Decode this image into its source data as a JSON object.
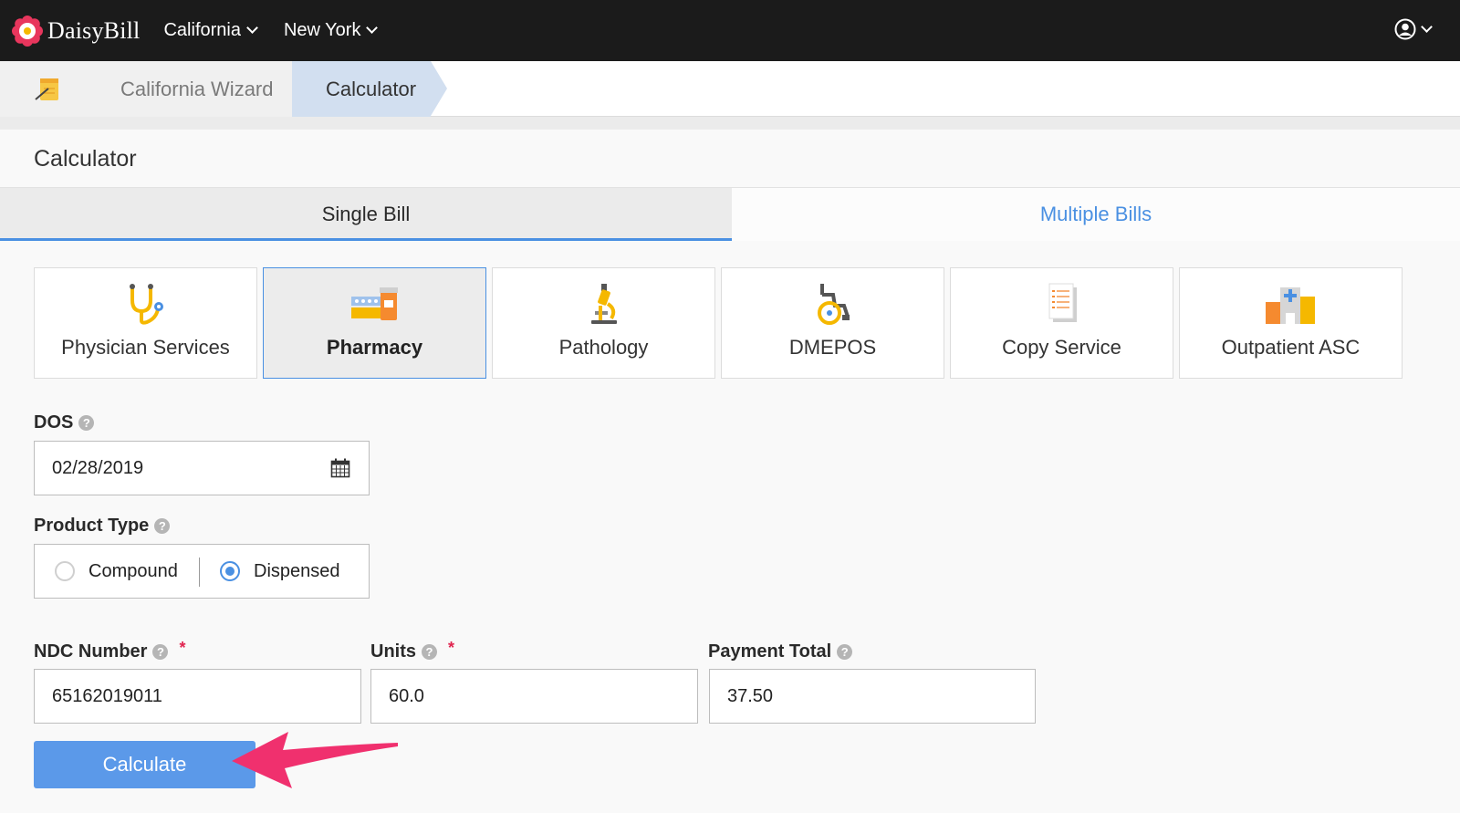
{
  "navbar": {
    "brand": "DaisyBill",
    "menus": [
      {
        "label": "California"
      },
      {
        "label": "New York"
      }
    ]
  },
  "breadcrumb": {
    "items": [
      "California Wizard",
      "Calculator"
    ]
  },
  "page": {
    "title": "Calculator"
  },
  "tabs": [
    {
      "label": "Single Bill",
      "active": true
    },
    {
      "label": "Multiple Bills",
      "active": false
    }
  ],
  "bill_types": [
    {
      "label": "Physician Services",
      "icon": "stethoscope-icon"
    },
    {
      "label": "Pharmacy",
      "icon": "pharmacy-icon",
      "selected": true
    },
    {
      "label": "Pathology",
      "icon": "microscope-icon"
    },
    {
      "label": "DMEPOS",
      "icon": "wheelchair-icon"
    },
    {
      "label": "Copy Service",
      "icon": "document-icon"
    },
    {
      "label": "Outpatient ASC",
      "icon": "hospital-icon"
    }
  ],
  "form": {
    "dos": {
      "label": "DOS",
      "value": "02/28/2019"
    },
    "product_type": {
      "label": "Product Type",
      "options": [
        {
          "label": "Compound",
          "checked": false
        },
        {
          "label": "Dispensed",
          "checked": true
        }
      ]
    },
    "ndc": {
      "label": "NDC Number",
      "value": "65162019011"
    },
    "units": {
      "label": "Units",
      "value": "60.0"
    },
    "payment_total": {
      "label": "Payment Total",
      "value": "37.50"
    },
    "help_glyph": "?",
    "required_glyph": "*"
  },
  "actions": {
    "calculate_label": "Calculate"
  },
  "colors": {
    "accent": "#4a90e2",
    "button": "#5b99e9",
    "annotation_arrow": "#f0306e",
    "navbar": "#1b1b1b"
  }
}
